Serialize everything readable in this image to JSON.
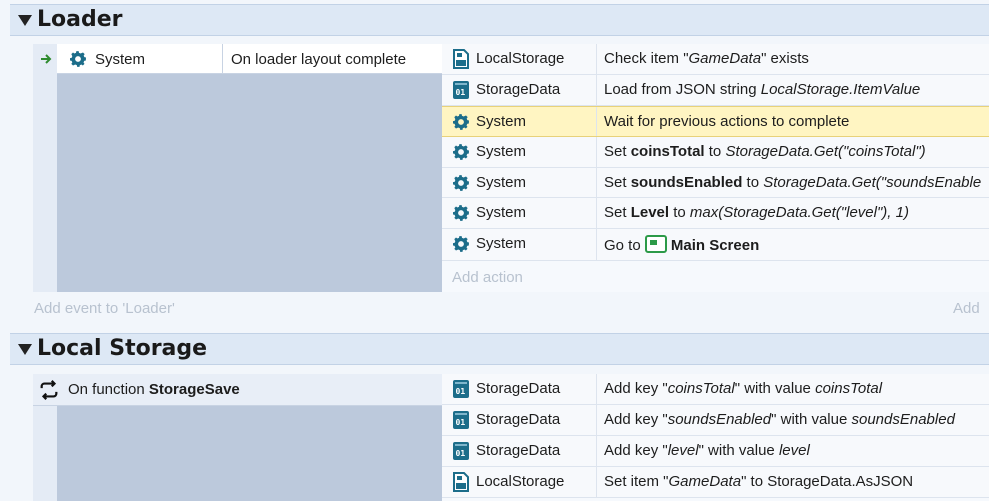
{
  "groups": [
    {
      "title": "Loader",
      "add_event": "Add event to 'Loader'",
      "add_right": "Add",
      "event": {
        "condition": {
          "object": "System",
          "text": "On loader layout complete"
        },
        "actions": [
          {
            "icon": "localstorage-icon",
            "object": "LocalStorage",
            "parts": [
              {
                "t": "Check item \""
              },
              {
                "t": "GameData",
                "i": true
              },
              {
                "t": "\" exists"
              }
            ]
          },
          {
            "icon": "storagedata-icon",
            "object": "StorageData",
            "parts": [
              {
                "t": "Load from JSON string "
              },
              {
                "t": "LocalStorage.ItemValue",
                "i": true
              }
            ]
          },
          {
            "icon": "gear-icon",
            "object": "System",
            "highlight": true,
            "parts": [
              {
                "t": "Wait for previous actions to complete"
              }
            ]
          },
          {
            "icon": "gear-icon",
            "object": "System",
            "parts": [
              {
                "t": "Set "
              },
              {
                "t": "coinsTotal",
                "b": true
              },
              {
                "t": " to "
              },
              {
                "t": "StorageData.Get(\"coinsTotal\")",
                "i": true
              }
            ]
          },
          {
            "icon": "gear-icon",
            "object": "System",
            "parts": [
              {
                "t": "Set "
              },
              {
                "t": "soundsEnabled",
                "b": true
              },
              {
                "t": " to "
              },
              {
                "t": "StorageData.Get(\"soundsEnable",
                "i": true
              }
            ]
          },
          {
            "icon": "gear-icon",
            "object": "System",
            "parts": [
              {
                "t": "Set "
              },
              {
                "t": "Level",
                "b": true
              },
              {
                "t": " to "
              },
              {
                "t": "max(StorageData.Get(\"level\"), 1)",
                "i": true
              }
            ]
          },
          {
            "icon": "gear-icon",
            "object": "System",
            "parts": [
              {
                "t": "Go to "
              },
              {
                "t": "[layout]",
                "layout": true
              },
              {
                "t": "Main Screen",
                "b": true
              }
            ]
          }
        ],
        "add_action": "Add action"
      }
    },
    {
      "title": "Local Storage",
      "event": {
        "condition": {
          "prefix": "On function ",
          "name": "StorageSave"
        },
        "actions": [
          {
            "icon": "storagedata-icon",
            "object": "StorageData",
            "parts": [
              {
                "t": "Add key \""
              },
              {
                "t": "coinsTotal",
                "i": true
              },
              {
                "t": "\" with value "
              },
              {
                "t": "coinsTotal",
                "i": true
              }
            ]
          },
          {
            "icon": "storagedata-icon",
            "object": "StorageData",
            "parts": [
              {
                "t": "Add key \""
              },
              {
                "t": "soundsEnabled",
                "i": true
              },
              {
                "t": "\" with value "
              },
              {
                "t": "soundsEnabled",
                "i": true
              }
            ]
          },
          {
            "icon": "storagedata-icon",
            "object": "StorageData",
            "parts": [
              {
                "t": "Add key \""
              },
              {
                "t": "level",
                "i": true
              },
              {
                "t": "\" with value "
              },
              {
                "t": "level",
                "i": true
              }
            ]
          },
          {
            "icon": "localstorage-icon",
            "object": "LocalStorage",
            "parts": [
              {
                "t": "Set item \""
              },
              {
                "t": "GameData",
                "i": true
              },
              {
                "t": "\" to StorageData.AsJSON"
              }
            ]
          }
        ]
      }
    }
  ]
}
